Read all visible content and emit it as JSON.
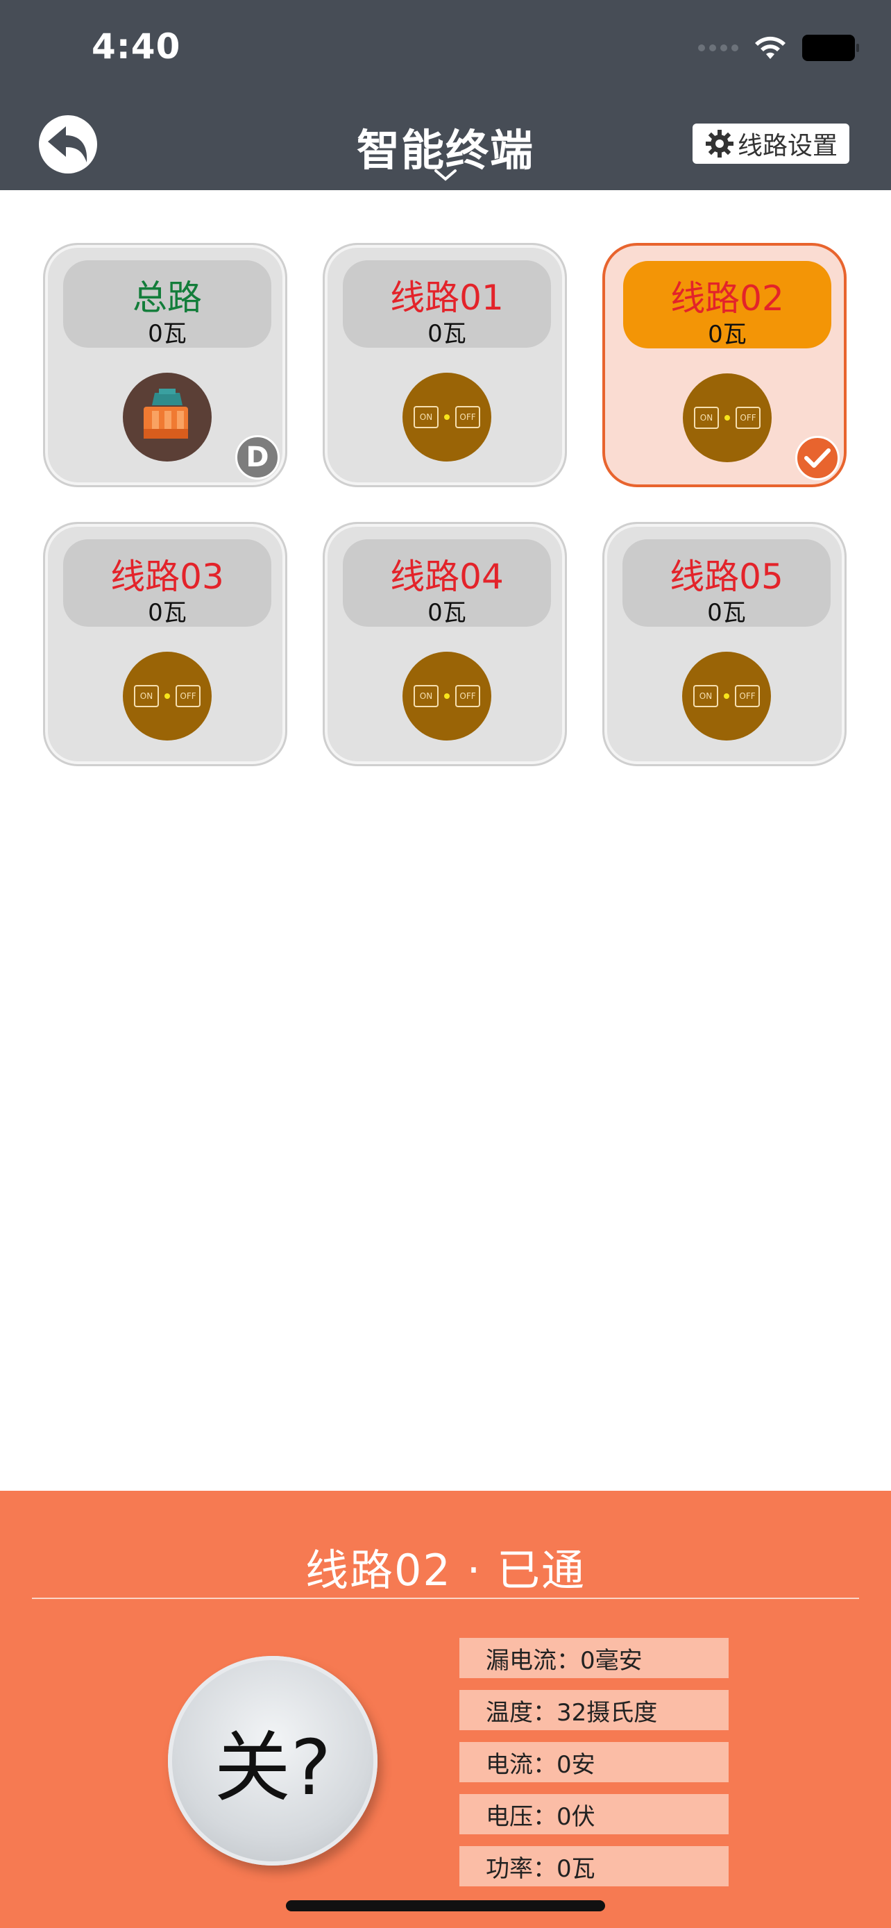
{
  "status_bar": {
    "time": "4:40"
  },
  "header": {
    "title": "智能终端",
    "settings_label": "线路设置",
    "back_icon": "back-arrow-icon",
    "settings_icon": "gear-icon",
    "background": "#474d56"
  },
  "circuits": [
    {
      "name": "总路",
      "power": "0瓦",
      "switch": "breaker",
      "badge": "D",
      "selected": false
    },
    {
      "name": "线路01",
      "power": "0瓦",
      "switch": "on-off",
      "selected": false
    },
    {
      "name": "线路02",
      "power": "0瓦",
      "switch": "on-off",
      "selected": true
    },
    {
      "name": "线路03",
      "power": "0瓦",
      "switch": "on-off",
      "selected": false
    },
    {
      "name": "线路04",
      "power": "0瓦",
      "switch": "on-off",
      "selected": false
    },
    {
      "name": "线路05",
      "power": "0瓦",
      "switch": "on-off",
      "selected": false
    }
  ],
  "switch_labels": {
    "on": "ON",
    "off": "OFF"
  },
  "panel": {
    "title": "线路02 · 已通",
    "power_button_label": "关?",
    "stats": [
      "漏电流：0毫安",
      "温度：32摄氏度",
      "电流：0安",
      "电压：0伏",
      "功率：0瓦"
    ],
    "background": "#f67a52"
  },
  "colors": {
    "circuit_name": "#e3232a",
    "main_name": "#137d3a",
    "selected_accent": "#e8642e",
    "selected_label_bg": "#f39506"
  }
}
